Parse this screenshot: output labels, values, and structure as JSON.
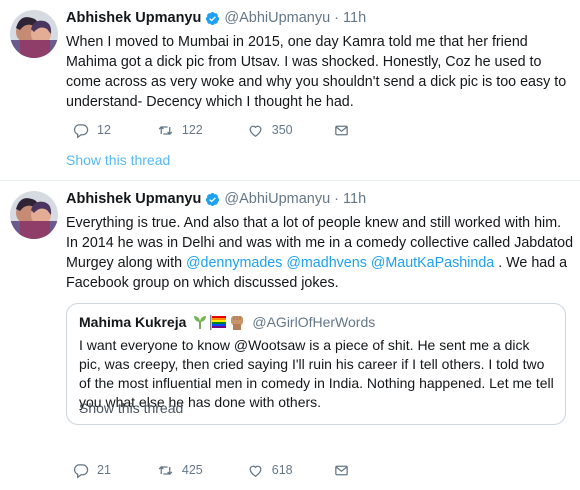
{
  "tweet1": {
    "name": "Abhishek Upmanyu",
    "handle": "@AbhiUpmanyu",
    "dot": "·",
    "time": "11h",
    "text": "When I moved to Mumbai in 2015, one day Kamra told me that her friend Mahima got a dick pic from Utsav. I was shocked. Honestly, Coz he used to come across as very woke and why you shouldn't send a dick pic is too easy to understand- Decency which I thought he had.",
    "replies": "12",
    "retweets": "122",
    "likes": "350",
    "show_thread": "Show this thread"
  },
  "tweet2": {
    "name": "Abhishek Upmanyu",
    "handle": "@AbhiUpmanyu",
    "dot": "·",
    "time": "11h",
    "text_part1": "Everything is true. And also that a lot of people knew and still worked with him. In 2014 he was in Delhi and was with me in a comedy collective called Jabdatod Murgey along with ",
    "mention1": "@dennymades",
    "mention2": "@madhvens",
    "mention3": "@MautKaPashinda",
    "text_part2": " . We had a Facebook group on which discussed jokes.",
    "replies": "21",
    "retweets": "425",
    "likes": "618"
  },
  "quote": {
    "name": "Mahima Kukreja",
    "emojis": [
      "seedling",
      "rainbow-flag",
      "raised-fist"
    ],
    "handle": "@AGirlOfHerWords",
    "text": "I want everyone to know @Wootsaw is a piece of shit. He sent me a dick pic, was creepy, then cried saying I'll ruin his career if I tell others. I told two of the most influential men in comedy in India. Nothing happened. Let me tell you what else he has done with others.",
    "show_thread": "Show this thread"
  },
  "colors": {
    "accent": "#1da1f2",
    "muted": "#657786",
    "border": "#e6ecf0"
  }
}
